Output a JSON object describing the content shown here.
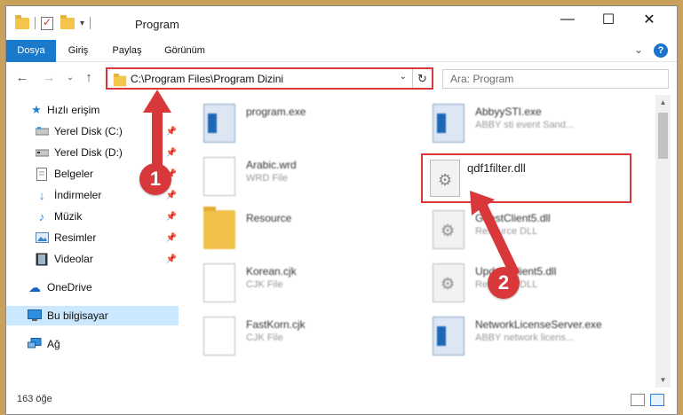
{
  "window": {
    "title": "Program",
    "controls": {
      "minimize": "—",
      "maximize": "☐",
      "close": "✕"
    }
  },
  "ribbon": {
    "tabs": [
      "Dosya",
      "Giriş",
      "Paylaş",
      "Görünüm"
    ],
    "help": "?",
    "collapse": "⌄"
  },
  "nav": {
    "back": "←",
    "forward": "→",
    "dropdown": "⌄",
    "up": "↑"
  },
  "address": {
    "path": "C:\\Program Files\\Program Dizini",
    "dropdown": "⌄",
    "refresh": "↻"
  },
  "search": {
    "placeholder": "Ara: Program"
  },
  "sidebar": {
    "items": [
      {
        "label": "Hızlı erişim",
        "icon": "star-icon"
      },
      {
        "label": "Yerel Disk (C:)",
        "icon": "drive-icon",
        "pinned": true
      },
      {
        "label": "Yerel Disk (D:)",
        "icon": "drive-icon",
        "pinned": true
      },
      {
        "label": "Belgeler",
        "icon": "documents-icon",
        "pinned": true
      },
      {
        "label": "İndirmeler",
        "icon": "download-icon",
        "pinned": true
      },
      {
        "label": "Müzik",
        "icon": "music-icon",
        "pinned": true
      },
      {
        "label": "Resimler",
        "icon": "pictures-icon",
        "pinned": true
      },
      {
        "label": "Videolar",
        "icon": "videos-icon",
        "pinned": true
      },
      {
        "label": "OneDrive",
        "icon": "cloud-icon"
      },
      {
        "label": "Bu bilgisayar",
        "icon": "computer-icon",
        "selected": true
      },
      {
        "label": "Ağ",
        "icon": "network-icon"
      }
    ],
    "pin_glyph": "📌"
  },
  "files": {
    "left": [
      {
        "name": "program.exe",
        "desc": "",
        "icon": "exe-icon"
      },
      {
        "name": "Arabic.wrd",
        "desc": "WRD File",
        "icon": "file-icon"
      },
      {
        "name": "Resource",
        "desc": "",
        "icon": "folder-icon"
      },
      {
        "name": "Korean.cjk",
        "desc": "CJK File",
        "icon": "file-icon"
      },
      {
        "name": "FastKorn.cjk",
        "desc": "CJK File",
        "icon": "file-icon"
      }
    ],
    "right": [
      {
        "name": "AbbyySTI.exe",
        "desc": "ABBY sti event Sand...",
        "icon": "exe-icon"
      },
      {
        "name": "qdf1filter.dll",
        "desc": "",
        "icon": "dll-icon"
      },
      {
        "name": "GuestClient5.dll",
        "desc": "Resource DLL",
        "icon": "dll-icon"
      },
      {
        "name": "UpdateClient5.dll",
        "desc": "Resource DLL",
        "icon": "dll-icon"
      },
      {
        "name": "NetworkLicenseServer.exe",
        "desc": "ABBY network licens...",
        "icon": "exe-icon"
      }
    ]
  },
  "callouts": {
    "one": "1",
    "two": "2"
  },
  "status": {
    "count": "163 öğe"
  },
  "colors": {
    "accent": "#1979ca",
    "highlight": "#d9383a"
  }
}
